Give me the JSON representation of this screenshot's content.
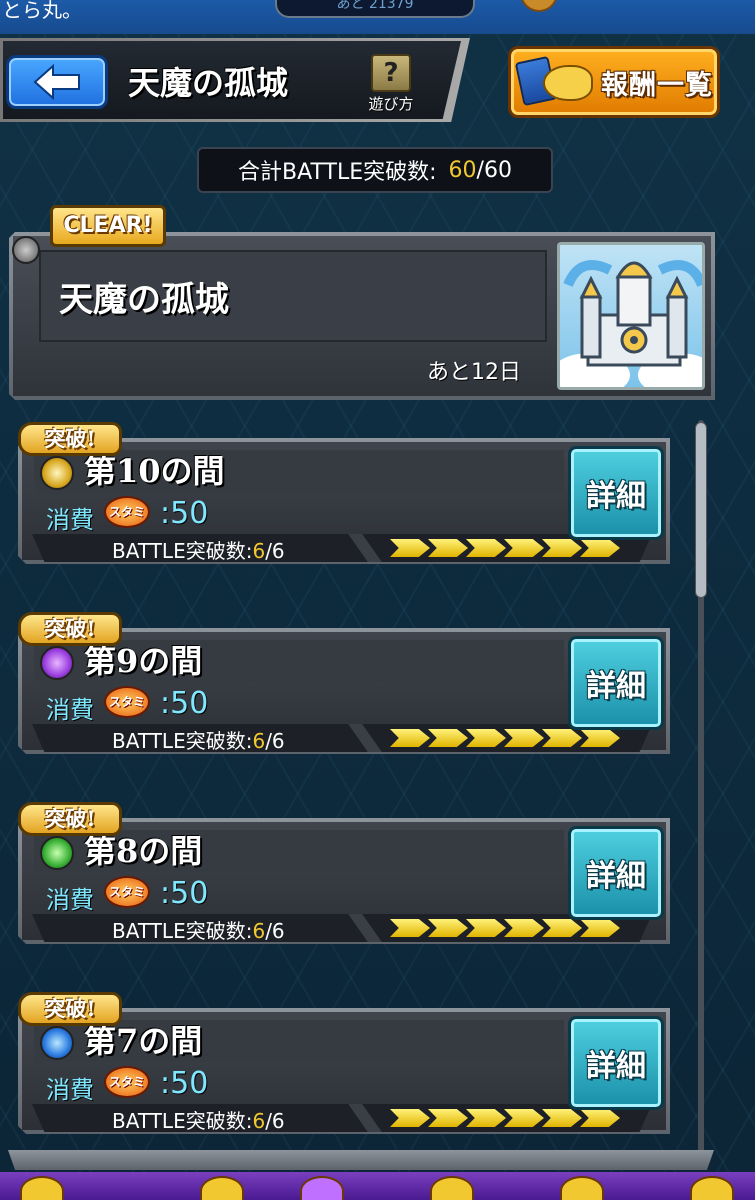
{
  "status": {
    "left_text": "とら丸。",
    "counter_text": "あと 21379"
  },
  "header": {
    "title": "天魔の孤城",
    "help_label": "遊び方",
    "help_symbol": "?",
    "reward_label": "報酬一覧"
  },
  "total": {
    "label": "合計BATTLE突破数:",
    "value": "60",
    "max": "/60"
  },
  "event": {
    "badge": "CLEAR!",
    "title": "天魔の孤城",
    "remaining": "あと12日"
  },
  "stages": [
    {
      "badge": "突破!",
      "name": "第10の間",
      "element": "light",
      "cost_label": "消費",
      "stamina_text": "スタミナ",
      "cost": ":50",
      "progress_label": "BATTLE突破数:",
      "progress_done": "6",
      "progress_total": "/6",
      "progress_fraction": 1.0,
      "detail": "詳細"
    },
    {
      "badge": "突破!",
      "name": "第9の間",
      "element": "dark",
      "cost_label": "消費",
      "stamina_text": "スタミナ",
      "cost": ":50",
      "progress_label": "BATTLE突破数:",
      "progress_done": "6",
      "progress_total": "/6",
      "progress_fraction": 1.0,
      "detail": "詳細"
    },
    {
      "badge": "突破!",
      "name": "第8の間",
      "element": "wood",
      "cost_label": "消費",
      "stamina_text": "スタミナ",
      "cost": ":50",
      "progress_label": "BATTLE突破数:",
      "progress_done": "6",
      "progress_total": "/6",
      "progress_fraction": 1.0,
      "detail": "詳細"
    },
    {
      "badge": "突破!",
      "name": "第7の間",
      "element": "water",
      "cost_label": "消費",
      "stamina_text": "スタミナ",
      "cost": ":50",
      "progress_label": "BATTLE突破数:",
      "progress_done": "6",
      "progress_total": "/6",
      "progress_fraction": 1.0,
      "detail": "詳細"
    }
  ],
  "colors": {
    "accent_gold": "#f2c830",
    "cyan_text": "#7fe8ff",
    "back_button": "#1f6fe0",
    "reward_button": "#e07a00",
    "detail_button": "#1a8fa8"
  }
}
